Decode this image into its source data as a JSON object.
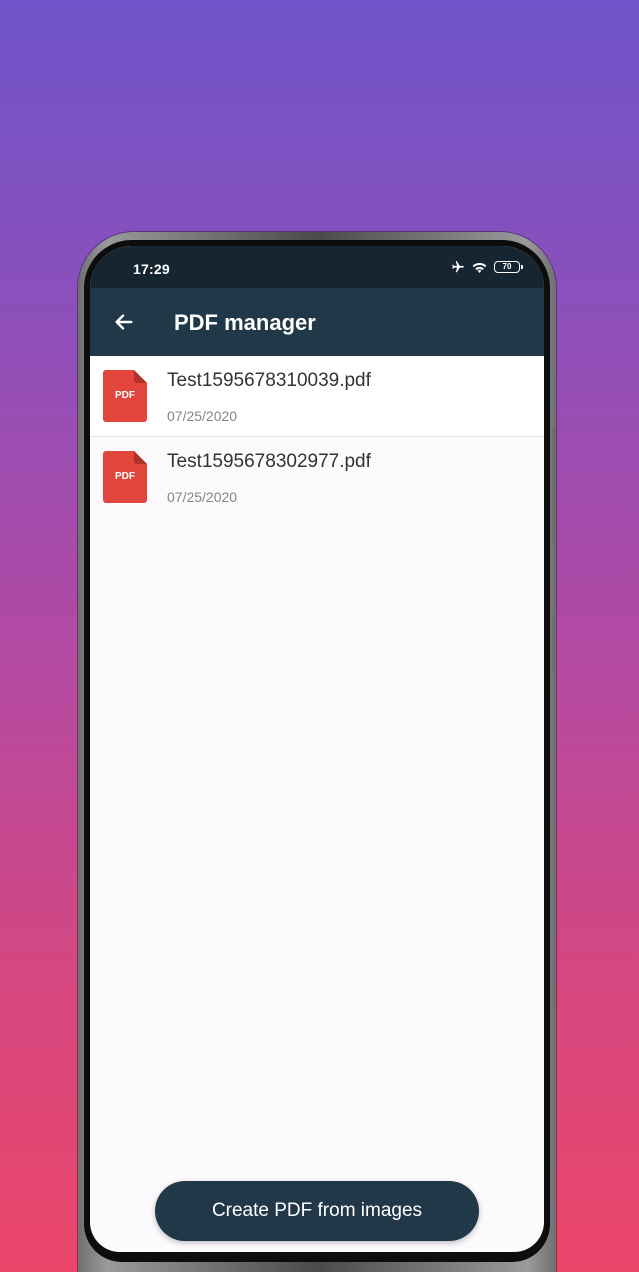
{
  "status_bar": {
    "time": "17:29",
    "battery_level": "70",
    "icons": [
      "airplane-icon",
      "wifi-icon",
      "battery-icon"
    ]
  },
  "app_bar": {
    "title": "PDF manager",
    "back_icon": "back-arrow-icon"
  },
  "files": [
    {
      "name": "Test1595678310039.pdf",
      "date": "07/25/2020",
      "icon_label": "PDF"
    },
    {
      "name": "Test1595678302977.pdf",
      "date": "07/25/2020",
      "icon_label": "PDF"
    }
  ],
  "create_button": {
    "label": "Create PDF from images"
  },
  "colors": {
    "app_bar": "#213848",
    "status_bar": "#152532",
    "pdf_icon": "#e2453c",
    "button": "#213848"
  }
}
